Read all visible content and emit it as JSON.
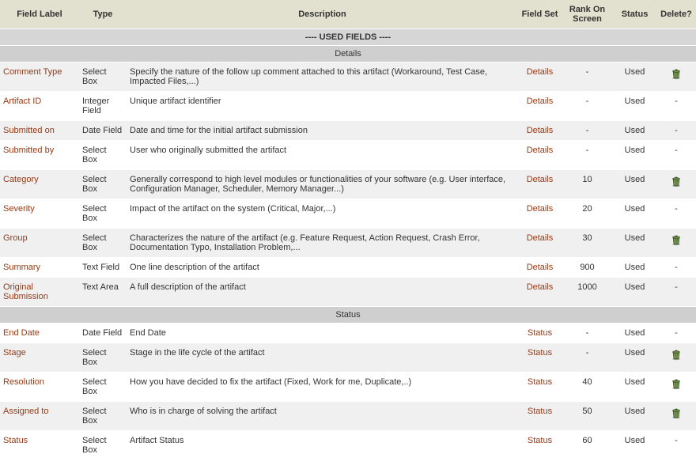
{
  "headers": {
    "label": "Field Label",
    "type": "Type",
    "desc": "Description",
    "fieldset": "Field Set",
    "rank": "Rank On Screen",
    "status": "Status",
    "delete": "Delete?"
  },
  "section_header": "---- USED FIELDS ----",
  "groups": [
    {
      "name": "Details",
      "rows": [
        {
          "label": "Comment Type",
          "type": "Select Box",
          "desc": "Specify the nature of the follow up comment attached to this artifact (Workaround, Test Case, Impacted Files,...)",
          "fieldset": "Details",
          "rank": "-",
          "status": "Used",
          "delete": "icon"
        },
        {
          "label": "Artifact ID",
          "type": "Integer Field",
          "desc": "Unique artifact identifier",
          "fieldset": "Details",
          "rank": "-",
          "status": "Used",
          "delete": "-"
        },
        {
          "label": "Submitted on",
          "type": "Date Field",
          "desc": "Date and time for the initial artifact submission",
          "fieldset": "Details",
          "rank": "-",
          "status": "Used",
          "delete": "-"
        },
        {
          "label": "Submitted by",
          "type": "Select Box",
          "desc": "User who originally submitted the artifact",
          "fieldset": "Details",
          "rank": "-",
          "status": "Used",
          "delete": "-"
        },
        {
          "label": "Category",
          "type": "Select Box",
          "desc": "Generally correspond to high level modules or functionalities of your software (e.g. User interface, Configuration Manager, Scheduler, Memory Manager...)",
          "fieldset": "Details",
          "rank": "10",
          "status": "Used",
          "delete": "icon"
        },
        {
          "label": "Severity",
          "type": "Select Box",
          "desc": "Impact of the artifact on the system (Critical, Major,...)",
          "fieldset": "Details",
          "rank": "20",
          "status": "Used",
          "delete": "-"
        },
        {
          "label": "Group",
          "type": "Select Box",
          "desc": "Characterizes the nature of the artifact (e.g. Feature Request, Action Request, Crash Error, Documentation Typo, Installation Problem,...",
          "fieldset": "Details",
          "rank": "30",
          "status": "Used",
          "delete": "icon"
        },
        {
          "label": "Summary",
          "type": "Text Field",
          "desc": "One line description of the artifact",
          "fieldset": "Details",
          "rank": "900",
          "status": "Used",
          "delete": "-"
        },
        {
          "label": "Original Submission",
          "type": "Text Area",
          "desc": "A full description of the artifact",
          "fieldset": "Details",
          "rank": "1000",
          "status": "Used",
          "delete": "-"
        }
      ]
    },
    {
      "name": "Status",
      "rows": [
        {
          "label": "End Date",
          "type": "Date Field",
          "desc": "End Date",
          "fieldset": "Status",
          "rank": "-",
          "status": "Used",
          "delete": "-"
        },
        {
          "label": "Stage",
          "type": "Select Box",
          "desc": "Stage in the life cycle of the artifact",
          "fieldset": "Status",
          "rank": "-",
          "status": "Used",
          "delete": "icon"
        },
        {
          "label": "Resolution",
          "type": "Select Box",
          "desc": "How you have decided to fix the artifact (Fixed, Work for me, Duplicate,..)",
          "fieldset": "Status",
          "rank": "40",
          "status": "Used",
          "delete": "icon"
        },
        {
          "label": "Assigned to",
          "type": "Select Box",
          "desc": "Who is in charge of solving the artifact",
          "fieldset": "Status",
          "rank": "50",
          "status": "Used",
          "delete": "icon"
        },
        {
          "label": "Status",
          "type": "Select Box",
          "desc": "Artifact Status",
          "fieldset": "Status",
          "rank": "60",
          "status": "Used",
          "delete": "-"
        }
      ]
    }
  ]
}
